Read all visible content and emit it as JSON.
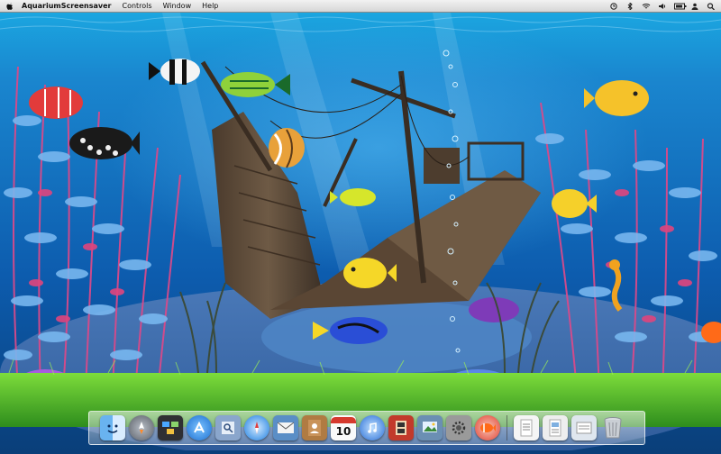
{
  "menubar": {
    "app_name": "AquariumScreensaver",
    "menus": [
      "Controls",
      "Window",
      "Help"
    ],
    "status_icons": [
      "timemachine-icon",
      "bluetooth-icon",
      "wifi-icon",
      "volume-icon",
      "battery-icon",
      "user-icon",
      "spotlight-icon"
    ]
  },
  "dock": {
    "apps": [
      {
        "name": "finder-icon",
        "color": "#5aa0e6"
      },
      {
        "name": "launchpad-icon",
        "color": "#7b7b85"
      },
      {
        "name": "mission-control-icon",
        "color": "#3a3a3a"
      },
      {
        "name": "app-store-icon",
        "color": "#2f7fe0"
      },
      {
        "name": "preview-icon",
        "color": "#6a8bbd"
      },
      {
        "name": "safari-icon",
        "color": "#1e90ff"
      },
      {
        "name": "mail-icon",
        "color": "#3b84c4"
      },
      {
        "name": "address-book-icon",
        "color": "#a5733b"
      },
      {
        "name": "calendar-icon",
        "color": "#ffffff"
      },
      {
        "name": "itunes-icon",
        "color": "#2a6ed6"
      },
      {
        "name": "photo-booth-icon",
        "color": "#c23a2b"
      },
      {
        "name": "iphoto-icon",
        "color": "#6b8fb3"
      },
      {
        "name": "system-preferences-icon",
        "color": "#8a8a8a"
      },
      {
        "name": "aquarium-icon",
        "color": "#e34234"
      }
    ],
    "docs": [
      {
        "name": "document-icon",
        "color": "#f5f5f5"
      },
      {
        "name": "pages-document-icon",
        "color": "#eeeeee"
      },
      {
        "name": "downloads-stack-icon",
        "color": "#dfe6ee"
      },
      {
        "name": "trash-icon",
        "color": "#c9ced4"
      }
    ],
    "calendar_day": "10"
  }
}
